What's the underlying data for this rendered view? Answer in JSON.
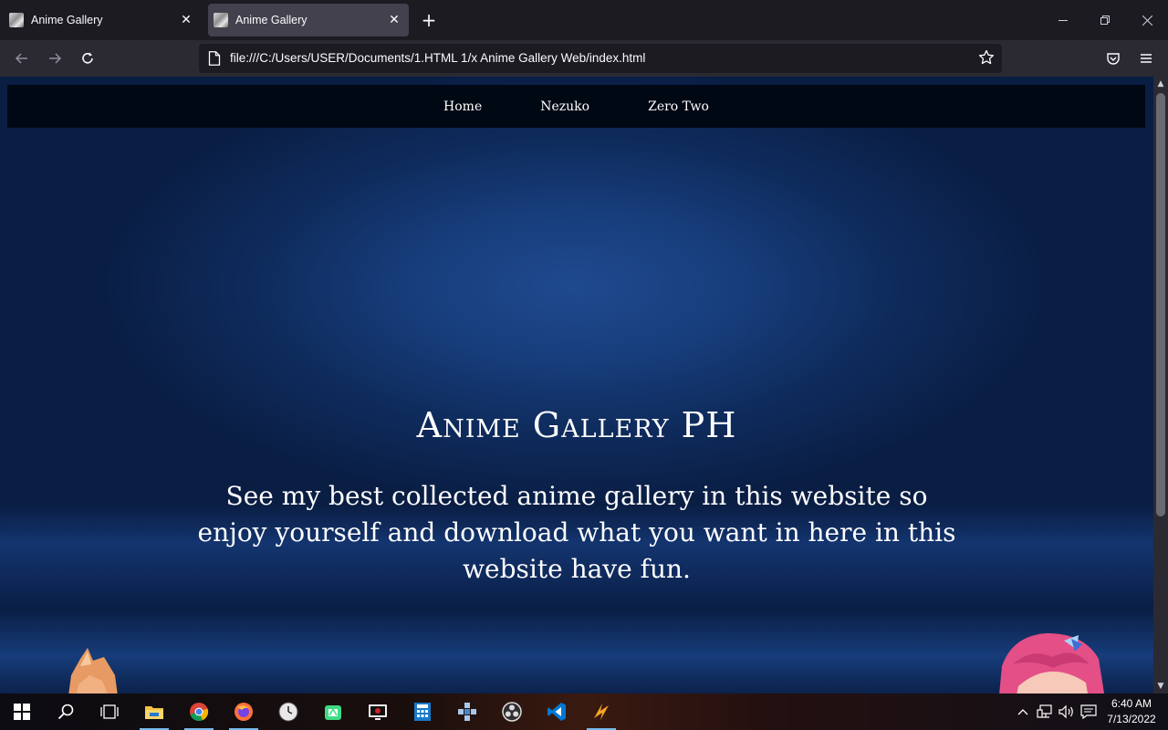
{
  "browser": {
    "tabs": [
      {
        "title": "Anime Gallery"
      },
      {
        "title": "Anime Gallery"
      }
    ],
    "url": "file:///C:/Users/USER/Documents/1.HTML 1/x Anime Gallery Web/index.html",
    "accent": "#1c1b22"
  },
  "page": {
    "nav": [
      "Home",
      "Nezuko",
      "Zero Two"
    ],
    "hero_title": "Anime Gallery PH",
    "hero_text": "See my best collected anime gallery in this website so enjoy yourself and download what you want in here in this website have fun.",
    "colors": {
      "nav_bg": "#000814",
      "hero_bg": "#173d7b",
      "text": "#ffffff"
    }
  },
  "taskbar": {
    "apps": [
      "start-icon",
      "search-icon",
      "task-view-icon",
      "file-explorer-icon",
      "chrome-icon",
      "firefox-icon",
      "clock-app-icon",
      "android-studio-icon",
      "media-player-icon",
      "calculator-icon",
      "ppsspp-icon",
      "obs-icon",
      "vscode-icon",
      "winamp-icon"
    ],
    "time": "6:40 AM",
    "date": "7/13/2022"
  }
}
